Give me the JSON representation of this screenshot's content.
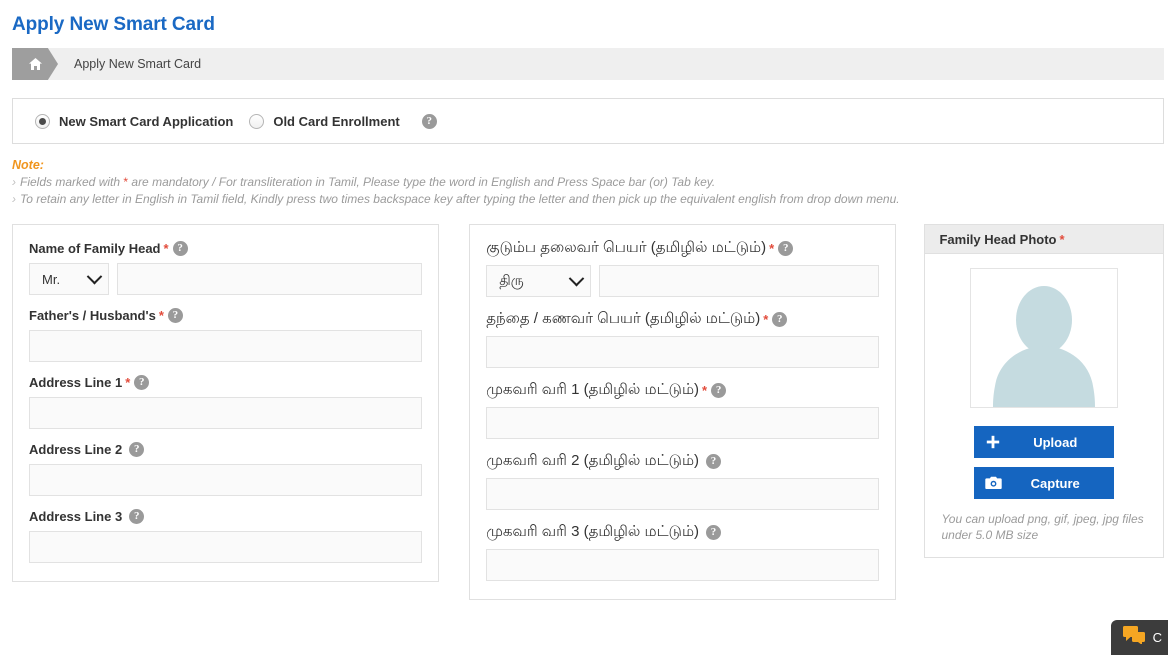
{
  "page": {
    "title": "Apply New Smart Card"
  },
  "breadcrumb": {
    "home_icon": "home-icon",
    "current": "Apply New Smart Card"
  },
  "application_type": {
    "options": [
      {
        "label": "New Smart Card Application",
        "selected": true
      },
      {
        "label": "Old Card Enrollment",
        "selected": false
      }
    ],
    "help_icon": "help-icon"
  },
  "note": {
    "title": "Note:",
    "lines": [
      {
        "prefix": "Fields marked with",
        "star": "*",
        "suffix": "are mandatory  / For transliteration in Tamil, Please type the word in English and Press Space bar (or) Tab key."
      },
      {
        "prefix": "",
        "star": "",
        "suffix": "To retain any letter in English in Tamil field, Kindly press two times backspace key after typing the letter and then pick up the equivalent english from drop down menu."
      }
    ]
  },
  "form_english": {
    "name_of_family_head": {
      "label": "Name of Family Head",
      "required": "*",
      "salutation_value": "Mr.",
      "value": ""
    },
    "father_husband": {
      "label": "Father's / Husband's",
      "required": "*",
      "value": ""
    },
    "address_line_1": {
      "label": "Address Line 1",
      "required": "*",
      "value": ""
    },
    "address_line_2": {
      "label": "Address Line 2",
      "required": "",
      "value": ""
    },
    "address_line_3": {
      "label": "Address Line 3",
      "required": "",
      "value": ""
    }
  },
  "form_tamil": {
    "name_of_family_head": {
      "label": "குடும்ப தலைவர் பெயர் (தமிழில் மட்டும்)",
      "required": "*",
      "salutation_value": "திரு",
      "value": ""
    },
    "father_husband": {
      "label": "தந்தை / கணவர் பெயர் (தமிழில் மட்டும்)",
      "required": "*",
      "value": ""
    },
    "address_line_1": {
      "label": "முகவரி வரி 1 (தமிழில் மட்டும்)",
      "required": "*",
      "value": ""
    },
    "address_line_2": {
      "label": "முகவரி வரி 2 (தமிழில் மட்டும்)",
      "required": "",
      "value": ""
    },
    "address_line_3": {
      "label": "முகவரி வரி 3 (தமிழில் மட்டும்)",
      "required": "",
      "value": ""
    }
  },
  "photo_panel": {
    "header": "Family Head Photo",
    "required": "*",
    "placeholder_icon": "user-avatar-icon",
    "upload_button": {
      "label": "Upload",
      "icon": "plus-icon"
    },
    "capture_button": {
      "label": "Capture",
      "icon": "camera-icon"
    },
    "note": "You can upload png, gif, jpeg, jpg files under 5.0 MB size"
  },
  "chat_widget": {
    "icon": "chat-bubbles-icon",
    "label": "C"
  },
  "colors": {
    "title_blue": "#1a69c4",
    "button_blue": "#1565c0",
    "note_orange": "#f0951e",
    "required_red": "#e24b3b",
    "help_gray": "#9a9a9a",
    "chat_dark": "#3c3c3c",
    "chat_orange": "#f5a623"
  }
}
